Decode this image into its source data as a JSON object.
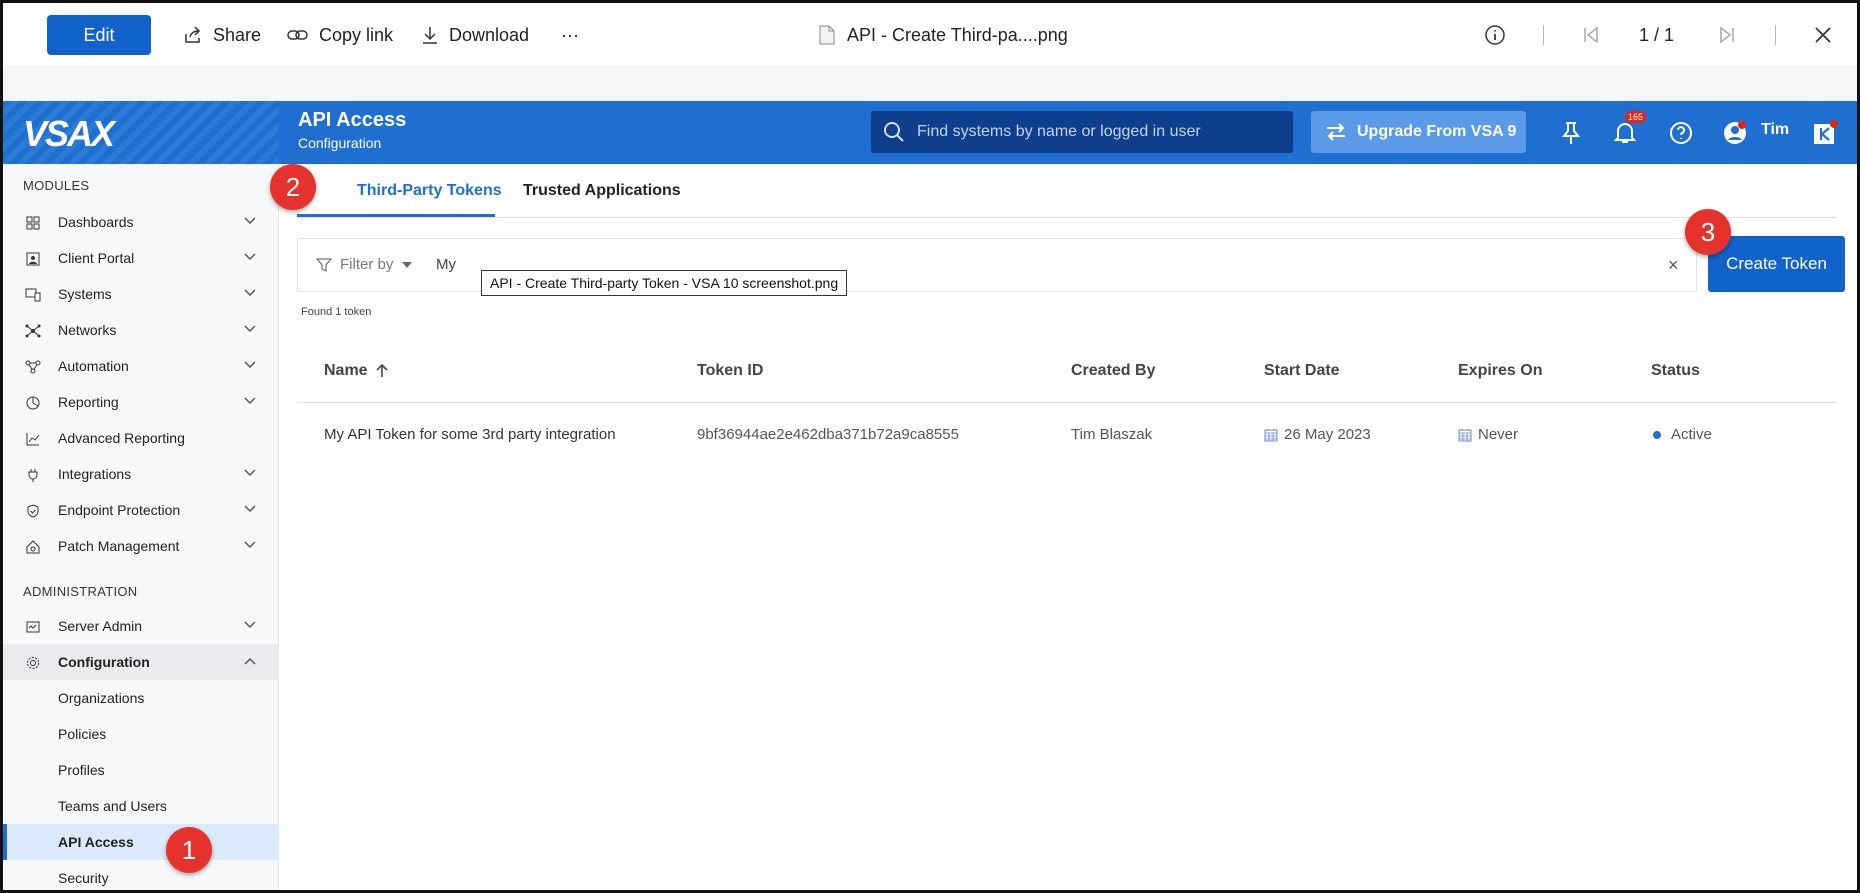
{
  "viewer": {
    "edit_label": "Edit",
    "share_label": "Share",
    "copy_link_label": "Copy link",
    "download_label": "Download",
    "more_label": "···",
    "file_title": "API - Create Third-pa....png",
    "pager": "1 / 1"
  },
  "header": {
    "logo_text": "VSAX",
    "title": "API Access",
    "subtitle": "Configuration",
    "search_placeholder": "Find systems by name or logged in user",
    "upgrade_label": "Upgrade From VSA 9",
    "notification_count": "165",
    "user_name": "Tim"
  },
  "sidebar": {
    "modules_heading": "MODULES",
    "modules": [
      {
        "label": "Dashboards",
        "icon": "dashboard-icon"
      },
      {
        "label": "Client Portal",
        "icon": "portal-icon"
      },
      {
        "label": "Systems",
        "icon": "systems-icon"
      },
      {
        "label": "Networks",
        "icon": "network-icon"
      },
      {
        "label": "Automation",
        "icon": "automation-icon"
      },
      {
        "label": "Reporting",
        "icon": "reporting-icon"
      },
      {
        "label": "Advanced Reporting",
        "icon": "chart-icon"
      },
      {
        "label": "Integrations",
        "icon": "plug-icon"
      },
      {
        "label": "Endpoint Protection",
        "icon": "shield-icon"
      },
      {
        "label": "Patch Management",
        "icon": "patch-icon"
      }
    ],
    "admin_heading": "ADMINISTRATION",
    "admin": [
      {
        "label": "Server Admin",
        "icon": "server-icon"
      },
      {
        "label": "Configuration",
        "icon": "gear-icon"
      }
    ],
    "config_children": [
      "Organizations",
      "Policies",
      "Profiles",
      "Teams and Users",
      "API Access",
      "Security"
    ]
  },
  "main": {
    "tabs": [
      "Third-Party Tokens",
      "Trusted Applications"
    ],
    "filter_label": "Filter by",
    "filter_value": "My",
    "clear_label": "×",
    "tooltip": "API - Create Third-party Token - VSA 10 screenshot.png",
    "create_label": "Create Token",
    "found_text": "Found 1 token",
    "columns": [
      "Name",
      "Token ID",
      "Created By",
      "Start Date",
      "Expires On",
      "Status"
    ],
    "rows": [
      {
        "name": "My API Token for some 3rd party integration",
        "token_id": "9bf36944ae2e462dba371b72a9ca8555",
        "created_by": "Tim Blaszak",
        "start_date": "26 May 2023",
        "expires_on": "Never",
        "status": "Active"
      }
    ]
  },
  "markers": [
    "1",
    "2",
    "3"
  ],
  "colors": {
    "brand_blue": "#1e6fd0",
    "button_blue": "#1263c9",
    "marker_red": "#e5322d"
  }
}
